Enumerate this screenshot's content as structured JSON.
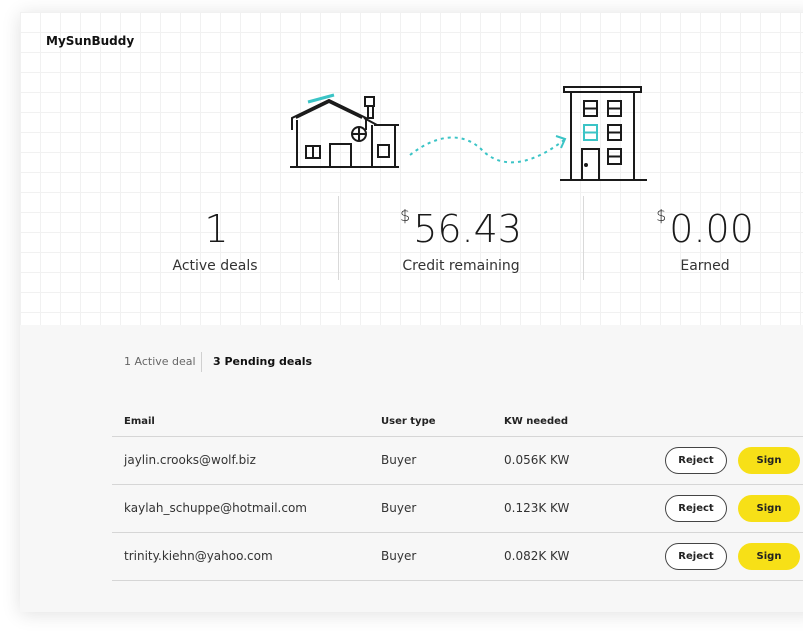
{
  "app": {
    "brand": "MySunBuddy"
  },
  "colors": {
    "accent_yellow": "#f7e017",
    "accent_teal": "#3bc4c6",
    "line": "#1a1a1a"
  },
  "illustration": {
    "left_icon": "house-icon",
    "right_icon": "apartment-building-icon",
    "connector": "dotted-arrow-icon"
  },
  "stats": [
    {
      "value": "1",
      "currency": "",
      "label": "Active deals"
    },
    {
      "value": "56.43",
      "currency": "$",
      "label": "Credit remaining"
    },
    {
      "value": "0.00",
      "currency": "$",
      "label": "Earned"
    }
  ],
  "tabs": {
    "active_deal": "1 Active deal",
    "pending_deals": "3 Pending deals"
  },
  "table": {
    "headers": {
      "email": "Email",
      "user_type": "User type",
      "kw_needed": "KW needed"
    },
    "rows": [
      {
        "email": "jaylin.crooks@wolf.biz",
        "user_type": "Buyer",
        "kw": "0.056K KW",
        "reject": "Reject",
        "sign": "Sign"
      },
      {
        "email": "kaylah_schuppe@hotmail.com",
        "user_type": "Buyer",
        "kw": "0.123K KW",
        "reject": "Reject",
        "sign": "Sign"
      },
      {
        "email": "trinity.kiehn@yahoo.com",
        "user_type": "Buyer",
        "kw": "0.082K KW",
        "reject": "Reject",
        "sign": "Sign"
      }
    ]
  }
}
